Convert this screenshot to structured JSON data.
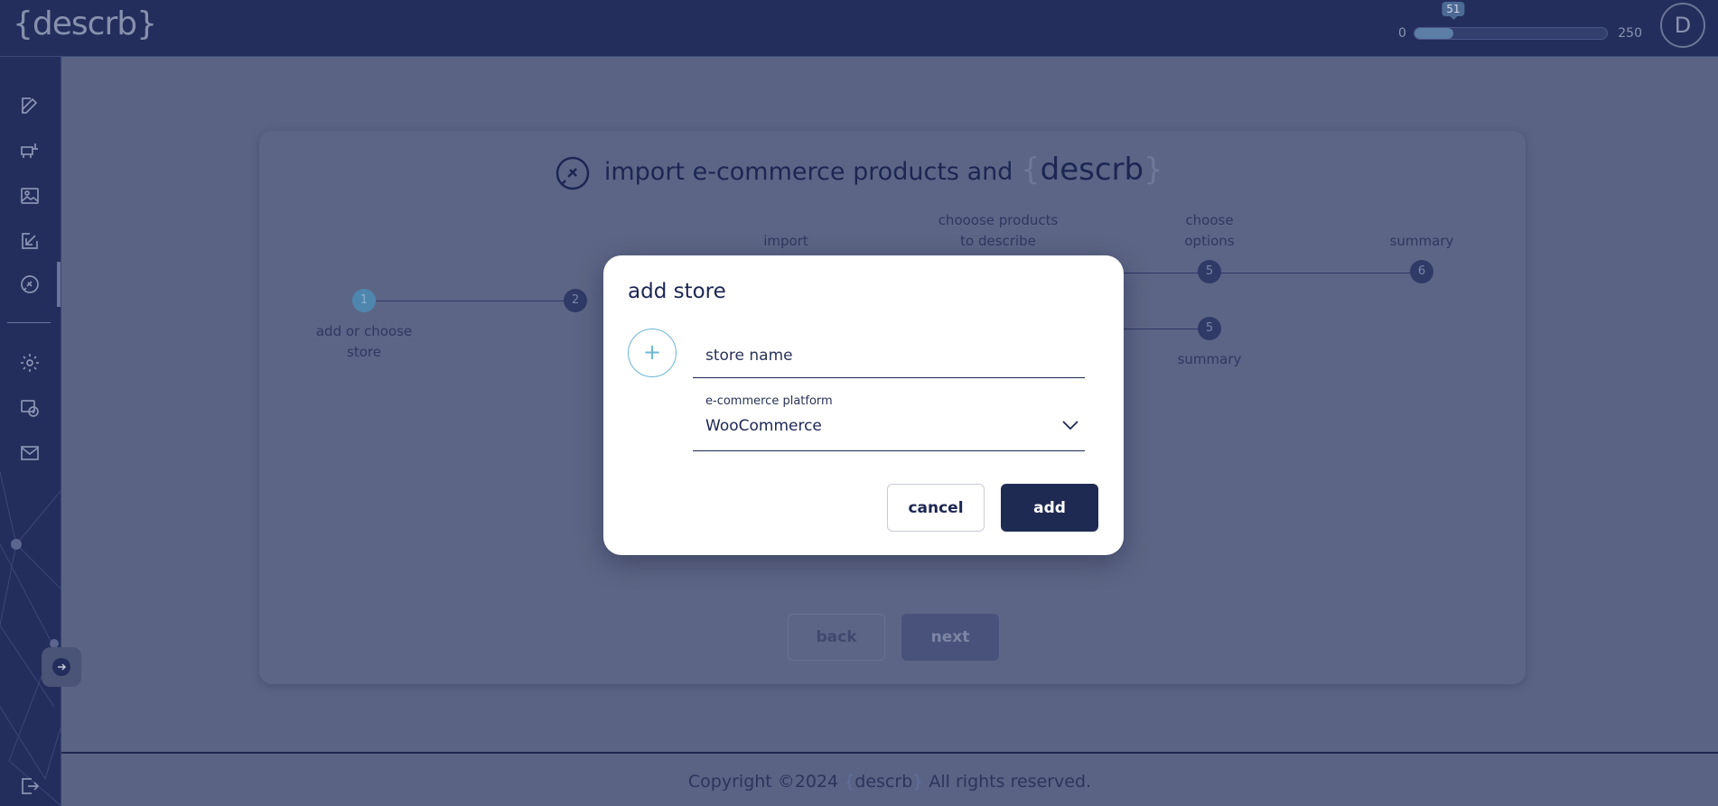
{
  "app": {
    "logo_text": "{descrb}",
    "logo_open": "{",
    "logo_word": "descrb",
    "logo_close": "}"
  },
  "credits": {
    "min_label": "0",
    "max_label": "250",
    "used": 51,
    "used_label": "51",
    "fraction": 0.204
  },
  "user": {
    "avatar_initial": "D"
  },
  "sidebar": {
    "items": [
      {
        "icon": "edit-icon"
      },
      {
        "icon": "product-icon"
      },
      {
        "icon": "image-icon"
      },
      {
        "icon": "import-arrow-icon"
      },
      {
        "icon": "plug-icon",
        "active": true
      },
      {
        "icon": "gear-icon"
      },
      {
        "icon": "billing-icon"
      },
      {
        "icon": "mail-icon"
      }
    ],
    "bottom_icon": "logout-icon"
  },
  "page": {
    "title_text": "import e-commerce products and",
    "title_logo_open": "{",
    "title_logo_word": "descrb",
    "title_logo_close": "}"
  },
  "stepper": {
    "steps_top": [
      {
        "number": "1",
        "label_line1": "add or choose",
        "label_line2": "store",
        "active": true
      },
      {
        "number": "2"
      }
    ],
    "labels_upper": [
      {
        "line1": "import",
        "line2": ""
      },
      {
        "line1": "chooose products",
        "line2": "to describe"
      },
      {
        "line1": "choose",
        "line2": "options"
      },
      {
        "line1": "summary",
        "line2": ""
      }
    ],
    "upper_numbers": [
      "5",
      "6"
    ],
    "lower_number": "5",
    "lower_label": "summary"
  },
  "nav_buttons": {
    "back_label": "back",
    "next_label": "next"
  },
  "modal": {
    "title": "add store",
    "add_symbol": "+",
    "store_name_placeholder": "store name",
    "platform_label": "e-commerce platform",
    "platform_value": "WooCommerce",
    "cancel_label": "cancel",
    "add_label": "add"
  },
  "footer": {
    "copyright_prefix": "Copyright ©2024",
    "logo_open": "{",
    "logo_word": "descrb",
    "logo_close": "}",
    "suffix": "All rights reserved."
  },
  "colors": {
    "topbar": "#232e5c",
    "overlay_bg": "#5b6384",
    "accent": "#4f86ae",
    "primary_button": "#1f2a52"
  }
}
